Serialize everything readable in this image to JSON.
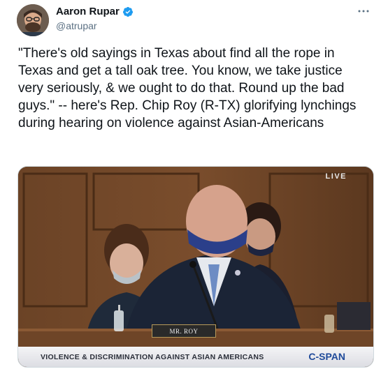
{
  "author": {
    "name": "Aaron Rupar",
    "handle": "@atrupar",
    "verified": true
  },
  "more_icon": "more-dots-icon",
  "tweet": {
    "text": "\"There's old sayings in Texas about find all the rope in Texas and get a tall oak tree. You know, we take justice very seriously, & we ought to do that. Round up the bad guys.\" -- here's Rep. Chip Roy (R-TX) glorifying lynchings during hearing on violence against Asian-Americans"
  },
  "media": {
    "live_label": "LIVE",
    "nameplate": "MR. ROY",
    "caption": "VIOLENCE & DISCRIMINATION AGAINST ASIAN AMERICANS",
    "network": "C-SPAN"
  },
  "colors": {
    "verified": "#1d9bf0",
    "handle": "#5b7083",
    "network": "#1f4a9a"
  }
}
